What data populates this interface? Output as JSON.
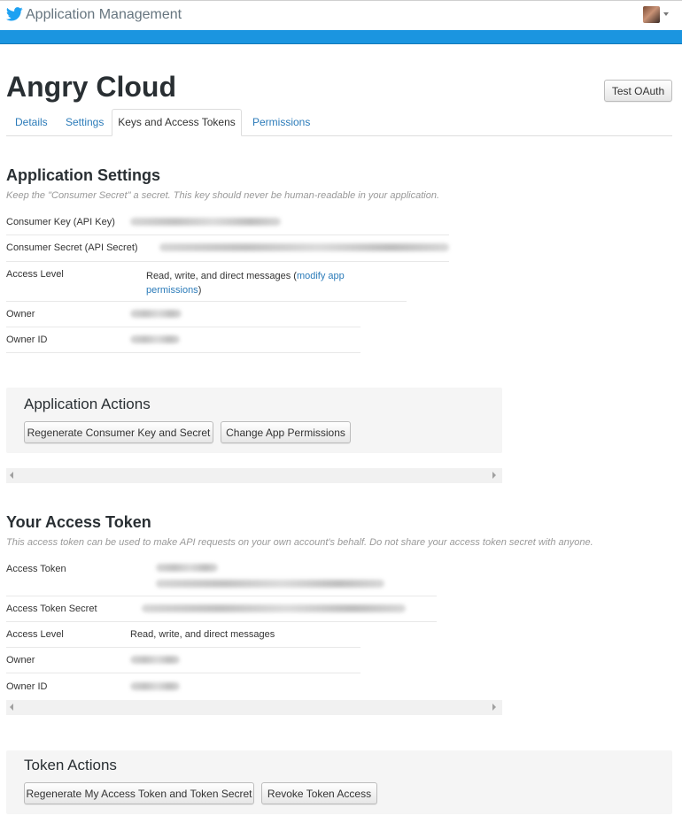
{
  "header": {
    "app_title": "Application Management",
    "brand_color": "#1b95e0"
  },
  "app": {
    "name": "Angry Cloud",
    "test_oauth_label": "Test OAuth"
  },
  "tabs": [
    {
      "label": "Details",
      "active": false
    },
    {
      "label": "Settings",
      "active": false
    },
    {
      "label": "Keys and Access Tokens",
      "active": true
    },
    {
      "label": "Permissions",
      "active": false
    }
  ],
  "app_settings": {
    "title": "Application Settings",
    "subtitle": "Keep the \"Consumer Secret\" a secret. This key should never be human-readable in your application.",
    "rows": {
      "consumer_key_label": "Consumer Key (API Key)",
      "consumer_secret_label": "Consumer Secret (API Secret)",
      "access_level_label": "Access Level",
      "access_level_value": "Read, write, and direct messages (",
      "modify_link": "modify app permissions",
      "access_level_close": ")",
      "owner_label": "Owner",
      "owner_id_label": "Owner ID"
    }
  },
  "app_actions": {
    "title": "Application Actions",
    "regenerate_label": "Regenerate Consumer Key and Secret",
    "change_permissions_label": "Change App Permissions"
  },
  "access_token": {
    "title": "Your Access Token",
    "subtitle": "This access token can be used to make API requests on your own account's behalf. Do not share your access token secret with anyone.",
    "rows": {
      "access_token_label": "Access Token",
      "access_token_secret_label": "Access Token Secret",
      "access_level_label": "Access Level",
      "access_level_value": "Read, write, and direct messages",
      "owner_label": "Owner",
      "owner_id_label": "Owner ID"
    }
  },
  "token_actions": {
    "title": "Token Actions",
    "regenerate_label": "Regenerate My Access Token and Token Secret",
    "revoke_label": "Revoke Token Access"
  }
}
